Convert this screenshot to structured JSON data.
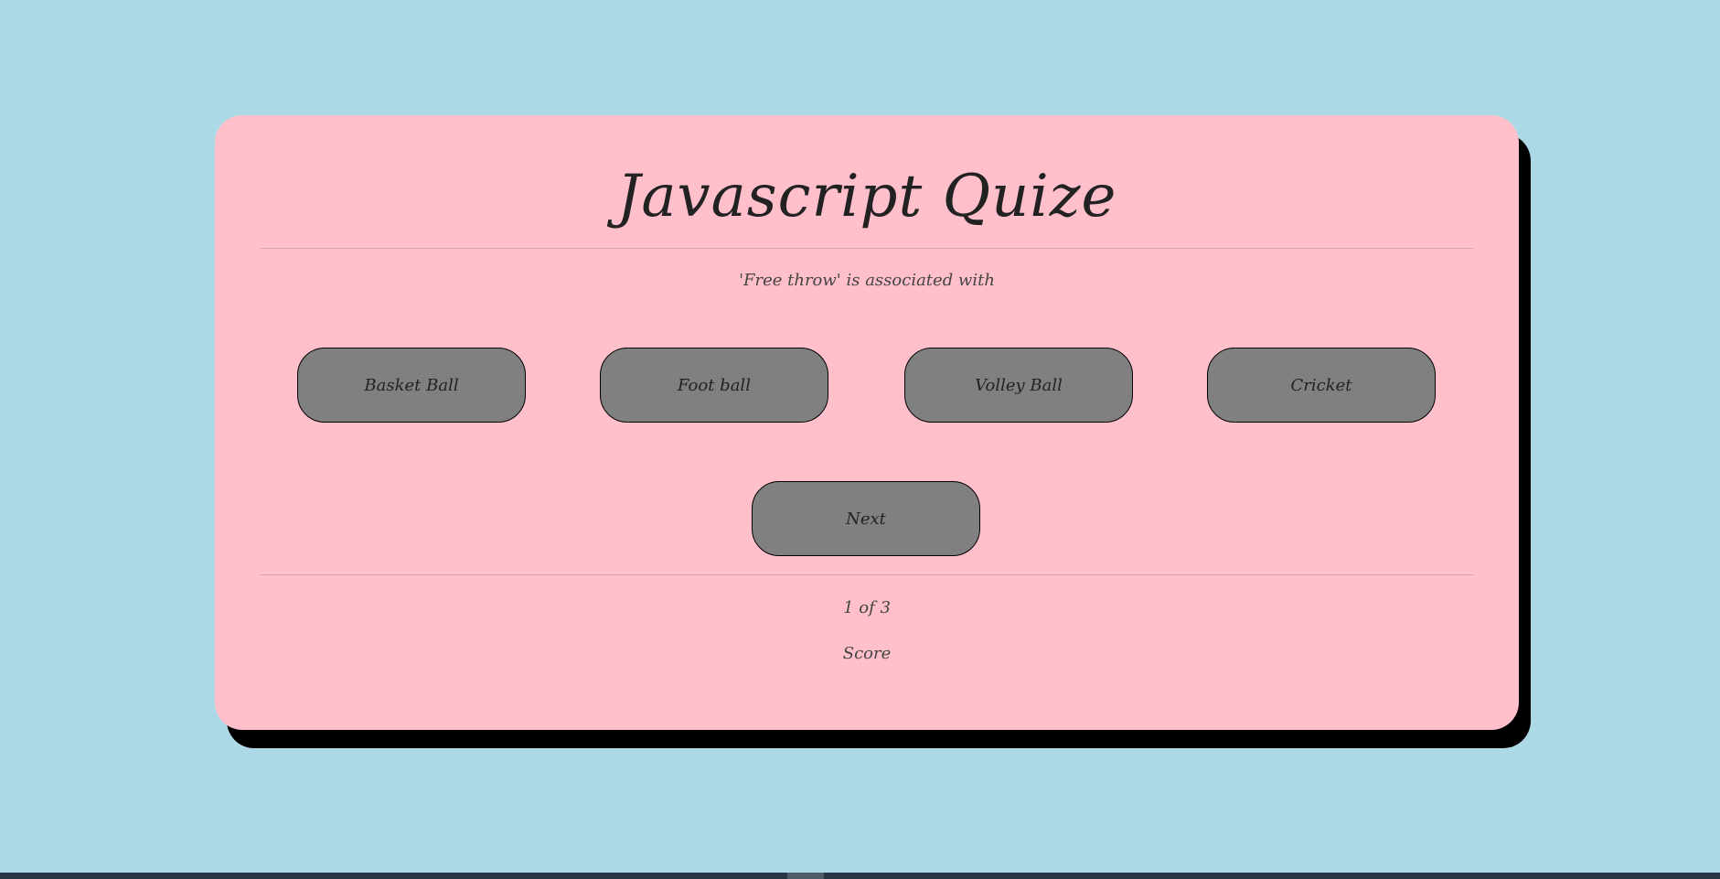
{
  "quiz": {
    "title": "Javascript Quize",
    "question": "'Free throw' is associated with",
    "options": [
      "Basket Ball",
      "Foot ball",
      "Volley Ball",
      "Cricket"
    ],
    "next_label": "Next",
    "progress": "1 of 3",
    "score_label": "Score"
  },
  "colors": {
    "background": "#add8e6",
    "card": "#ffc0cb",
    "button": "#808080"
  }
}
